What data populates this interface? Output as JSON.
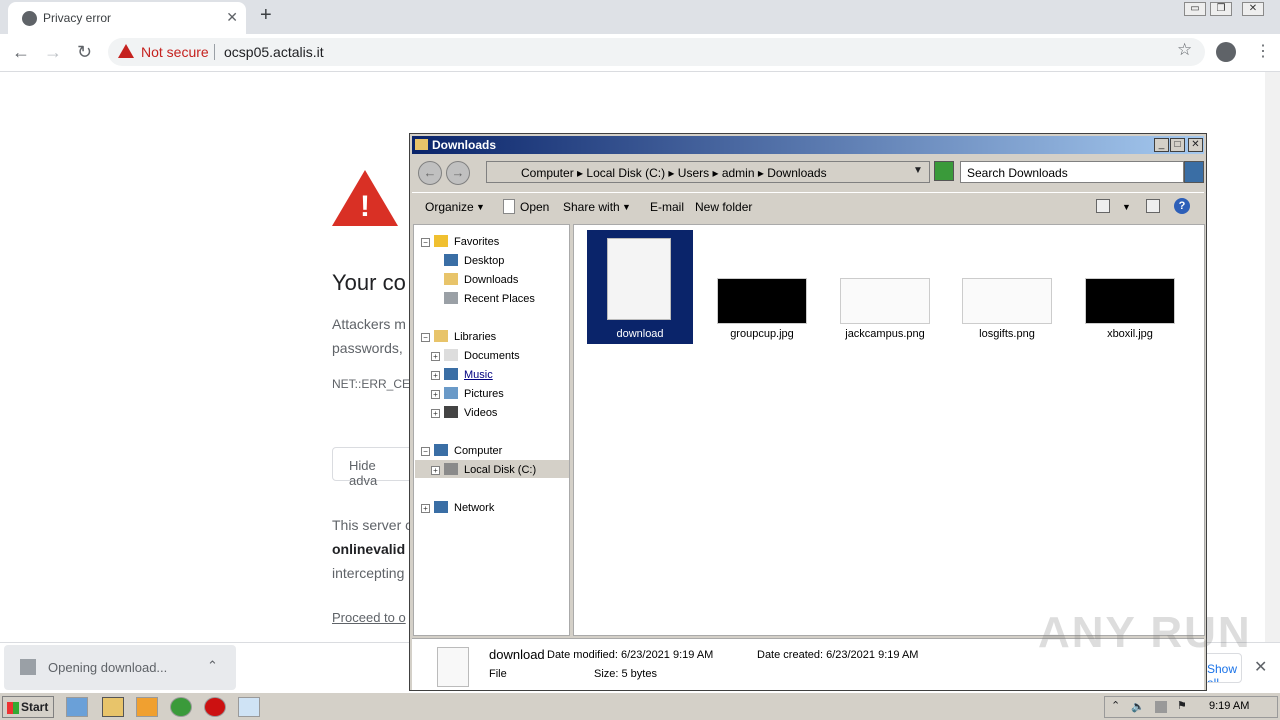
{
  "browser": {
    "tab_title": "Privacy error",
    "tab_close": "✕",
    "new_tab": "+",
    "security_label": "Not secure",
    "url": "ocsp05.actalis.it",
    "window_buttons": [
      "▭",
      "❐",
      "✕"
    ]
  },
  "error_page": {
    "heading": "Your co",
    "para1_line1": "Attackers m",
    "para1_line2": "passwords,",
    "error_code": "NET::ERR_CER",
    "hide_button": "Hide adva",
    "para2_line1": "This server c",
    "para2_line2": "onlinevalid",
    "para2_line3": "intercepting",
    "proceed_link": "Proceed to o"
  },
  "download_shelf": {
    "item_text": "Opening download...",
    "show_all": "Show all",
    "close": "✕"
  },
  "explorer": {
    "title": "Downloads",
    "window_buttons": [
      "_",
      "□",
      "✕"
    ],
    "breadcrumb": [
      "Computer",
      "Local Disk (C:)",
      "Users",
      "admin",
      "Downloads"
    ],
    "search_placeholder": "Search Downloads",
    "commands": {
      "organize": "Organize",
      "open": "Open",
      "share_with": "Share with",
      "email": "E-mail",
      "new_folder": "New folder"
    },
    "nav": {
      "favorites": "Favorites",
      "desktop": "Desktop",
      "downloads": "Downloads",
      "recent_places": "Recent Places",
      "libraries": "Libraries",
      "documents": "Documents",
      "music": "Music",
      "pictures": "Pictures",
      "videos": "Videos",
      "computer": "Computer",
      "local_disk": "Local Disk (C:)",
      "network": "Network"
    },
    "files": [
      {
        "name": "download"
      },
      {
        "name": "groupcup.jpg"
      },
      {
        "name": "jackcampus.png"
      },
      {
        "name": "losgifts.png"
      },
      {
        "name": "xboxil.jpg"
      }
    ],
    "status": {
      "file_name": "download",
      "date_modified": "Date modified: 6/23/2021 9:19 AM",
      "date_created": "Date created: 6/23/2021 9:19 AM",
      "type": "File",
      "size": "Size: 5 bytes"
    }
  },
  "taskbar": {
    "start_label": "Start",
    "clock": "9:19 AM"
  },
  "watermark": "ANY RUN",
  "colors": {
    "danger": "#c5221f",
    "selection": "#0a246a",
    "title_gradient_start": "#0a246a"
  }
}
